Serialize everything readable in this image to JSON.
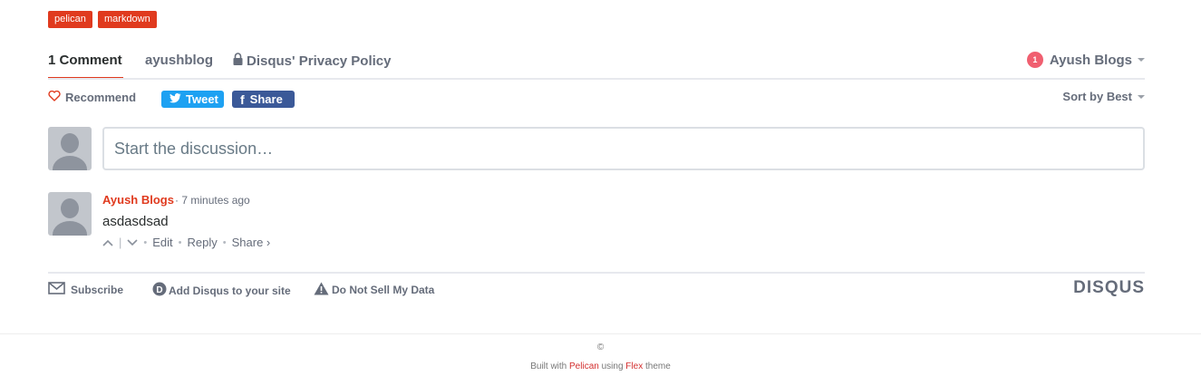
{
  "tags": [
    "pelican",
    "markdown"
  ],
  "header": {
    "comment_count": "1 Comment",
    "forum_name": "ayushblog",
    "privacy_label": "Disqus' Privacy Policy",
    "notification_count": "1",
    "user_name": "Ayush Blogs"
  },
  "actions": {
    "recommend": "Recommend",
    "tweet": "Tweet",
    "share": "Share",
    "sort": "Sort by Best"
  },
  "input": {
    "placeholder": "Start the discussion…"
  },
  "comment": {
    "author": "Ayush Blogs",
    "time": "7 minutes ago",
    "body": "asdasdsad",
    "edit": "Edit",
    "reply": "Reply",
    "share": "Share ›"
  },
  "footer_links": {
    "subscribe": "Subscribe",
    "add_disqus": "Add Disqus to your site",
    "do_not_sell": "Do Not Sell My Data",
    "logo": "DISQUS"
  },
  "site_footer": {
    "copyright": "©",
    "built_prefix": "Built with",
    "pelican": "Pelican",
    "using": "using",
    "flex": "Flex",
    "theme": "theme"
  },
  "colors": {
    "accent": "#e03a1e",
    "tweet": "#1da1f2",
    "facebook": "#3b5998",
    "notification": "#f05f70"
  }
}
